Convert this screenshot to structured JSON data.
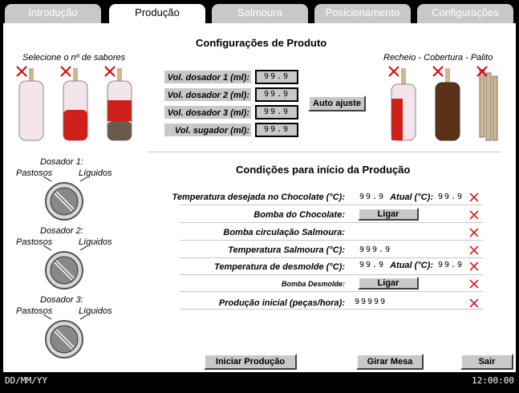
{
  "tabs": [
    {
      "label": "Introdução"
    },
    {
      "label": "Produção"
    },
    {
      "label": "Salmoura"
    },
    {
      "label": "Posicionamento"
    },
    {
      "label": "Configurações"
    }
  ],
  "product_config": {
    "title": "Configurações de Produto",
    "flavors_label": "Selecione o nº de sabores",
    "filling_label": "Recheio - Cobertura - Palito",
    "dosers": [
      {
        "label": "Vol. dosador 1 (ml):",
        "value": "99.9"
      },
      {
        "label": "Vol. dosador 2 (ml):",
        "value": "99.9"
      },
      {
        "label": "Vol. dosador 3 (ml):",
        "value": "99.9"
      },
      {
        "label": "Vol. sugador (ml):",
        "value": "99.9"
      }
    ],
    "auto_adjust": "Auto ajuste"
  },
  "dosers_left": [
    {
      "title": "Dosador 1:",
      "left": "Pastosos",
      "right": "Líquidos"
    },
    {
      "title": "Dosador 2:",
      "left": "Pastosos",
      "right": "Líquidos"
    },
    {
      "title": "Dosador 3:",
      "left": "Pastosos",
      "right": "Líquidos"
    }
  ],
  "conditions": {
    "title": "Condições para início da Produção",
    "rows": [
      {
        "label": "Temperatura desejada no Chocolate (°C):",
        "value": "99.9",
        "actual_label": "Atual (°C):",
        "actual_value": "99.9"
      },
      {
        "label": "Bomba do Chocolate:",
        "button": "Ligar"
      },
      {
        "label": "Bomba circulação Salmoura:"
      },
      {
        "label": "Temperatura Salmoura (°C):",
        "value": "999.9"
      },
      {
        "label": "Temperatura de desmolde (°C):",
        "value": "99.9",
        "actual_label": "Atual (°C):",
        "actual_value": "99.9"
      },
      {
        "label": "Bomba Desmolde:",
        "button": "Ligar"
      },
      {
        "label": "Produção inicial (peças/hora):",
        "value": "99999"
      }
    ]
  },
  "actions": {
    "start": "Iniciar Produção",
    "rotate": "Girar Mesa",
    "exit": "Sair"
  },
  "status": {
    "date": "DD/MM/YY",
    "time": "12:00:00"
  },
  "colors": {
    "tab_bg": "#c8c8c8",
    "x_red": "#e00000",
    "popsicle_red": "#d0201c",
    "popsicle_brown": "#5a3218"
  }
}
